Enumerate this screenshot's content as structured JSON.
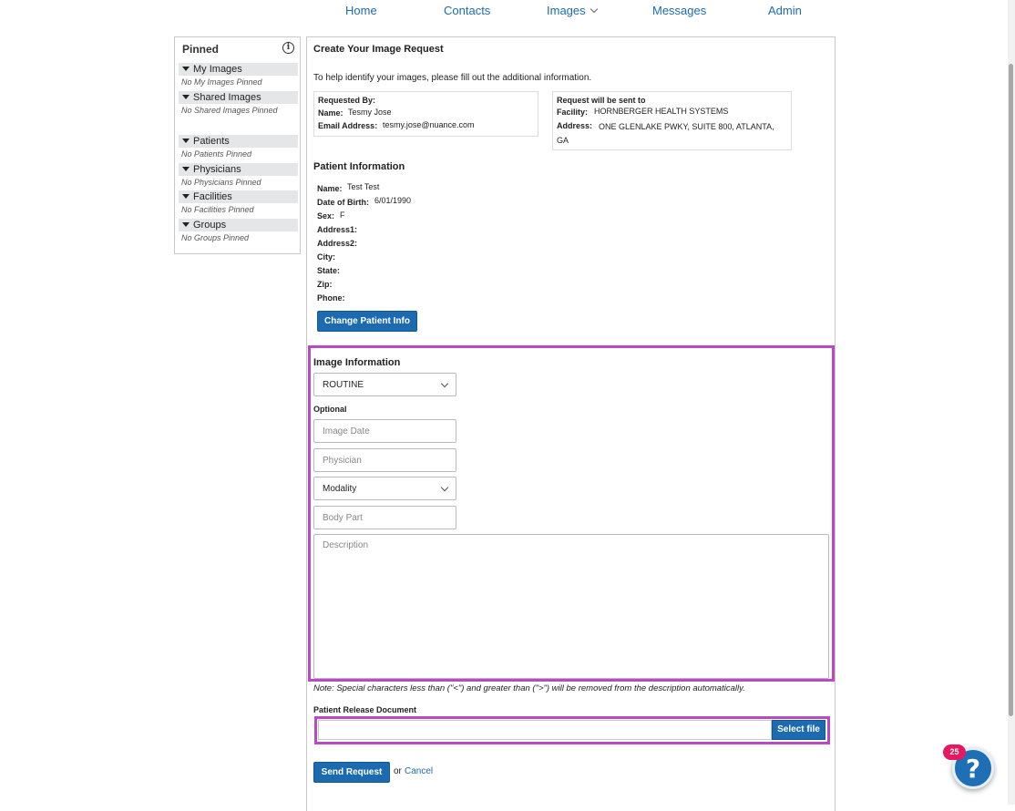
{
  "nav": {
    "home": "Home",
    "contacts": "Contacts",
    "images": "Images",
    "messages": "Messages",
    "admin": "Admin"
  },
  "pinned": {
    "title": "Pinned",
    "groups": [
      {
        "label": "My Images",
        "empty": "No My Images Pinned"
      },
      {
        "label": "Shared Images",
        "empty": "No Shared Images Pinned"
      },
      {
        "label": "Patients",
        "empty": "No Patients Pinned"
      },
      {
        "label": "Physicians",
        "empty": "No Physicians Pinned"
      },
      {
        "label": "Facilities",
        "empty": "No Facilities Pinned"
      },
      {
        "label": "Groups",
        "empty": "No Groups Pinned"
      }
    ]
  },
  "form": {
    "title": "Create Your Image Request",
    "intro": "To help identify your images, please fill out the additional information.",
    "requested_by": {
      "heading": "Requested By:",
      "name_label": "Name:",
      "name_value": "Tesmy Jose",
      "email_label": "Email Address:",
      "email_value": "tesmy.jose@nuance.com"
    },
    "sent_to": {
      "heading": "Request will be sent to",
      "facility_label": "Facility:",
      "facility_value": "HORNBERGER HEALTH SYSTEMS",
      "address_label": "Address:",
      "address_value": "ONE GLENLAKE PWKY, SUITE 800, ATLANTA, GA"
    },
    "patient": {
      "heading": "Patient Information",
      "name_label": "Name:",
      "name_value": "Test Test",
      "dob_label": "Date of Birth:",
      "dob_value": "6/01/1990",
      "sex_label": "Sex:",
      "sex_value": "F",
      "address1_label": "Address1:",
      "address2_label": "Address2:",
      "city_label": "City:",
      "state_label": "State:",
      "zip_label": "Zip:",
      "phone_label": "Phone:",
      "change_button": "Change Patient Info"
    },
    "image_info": {
      "heading": "Image Information",
      "priority_value": "ROUTINE",
      "optional_label": "Optional",
      "image_date_placeholder": "Image Date",
      "physician_placeholder": "Physician",
      "modality_value": "Modality",
      "body_part_placeholder": "Body Part",
      "description_placeholder": "Description"
    },
    "note": "Note: Special characters less than (\"<\") and greater than (\">\") will be removed from the description automatically.",
    "release": {
      "label": "Patient Release Document",
      "select_button": "Select file"
    },
    "send_button": "Send Request",
    "or_text": "or",
    "cancel_link": "Cancel"
  },
  "help": {
    "badge_count": "25",
    "icon": "?"
  },
  "colors": {
    "accent": "#1c6bb0",
    "highlight": "#b84ac3",
    "badge": "#e5195f"
  }
}
